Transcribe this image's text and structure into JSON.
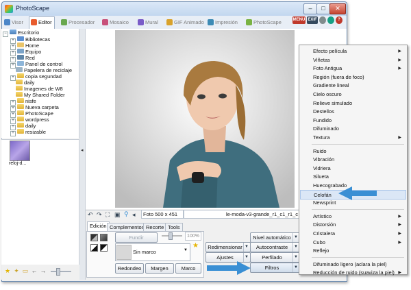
{
  "window": {
    "title": "PhotoScape",
    "min_glyph": "–",
    "max_glyph": "□",
    "close_glyph": "✕"
  },
  "tabs": [
    {
      "label": "Visor",
      "color": "#4b86c8",
      "active": false
    },
    {
      "label": "Editor",
      "color": "#e85c2e",
      "active": true
    },
    {
      "label": "Procesador",
      "color": "#6aa84f",
      "active": false
    },
    {
      "label": "Mosaico",
      "color": "#c8507a",
      "active": false
    },
    {
      "label": "Mural",
      "color": "#7a5cc8",
      "active": false
    },
    {
      "label": "GIF Animado",
      "color": "#d9a22b",
      "active": false
    },
    {
      "label": "Impresión",
      "color": "#3d8bb5",
      "active": false
    },
    {
      "label": "PhotoScape",
      "color": "#7ab343",
      "active": false
    }
  ],
  "header_icons": [
    {
      "label": "MENU",
      "color": "#c0392b"
    },
    {
      "label": "EXIF",
      "color": "#34495e"
    },
    {
      "label": "",
      "color": "#7f8c8d"
    },
    {
      "label": "",
      "color": "#16a085"
    },
    {
      "label": "?",
      "color": "#c0392b"
    }
  ],
  "tree": {
    "root": "Escritorio",
    "items": [
      {
        "label": "Bibliotecas",
        "expander": "+"
      },
      {
        "label": "Home",
        "expander": "+"
      },
      {
        "label": "Equipo",
        "expander": "+"
      },
      {
        "label": "Red",
        "expander": "+"
      },
      {
        "label": "Panel de control",
        "expander": "+"
      },
      {
        "label": "Papelera de reciclaje",
        "expander": ""
      },
      {
        "label": "copia segundad",
        "expander": "+"
      },
      {
        "label": "daily",
        "expander": ""
      },
      {
        "label": "Imagenes de W8",
        "expander": ""
      },
      {
        "label": "My Shared Folder",
        "expander": ""
      },
      {
        "label": "nisfe",
        "expander": "+"
      },
      {
        "label": "Nueva carpeta",
        "expander": "+"
      },
      {
        "label": "PhotoScape",
        "expander": "+"
      },
      {
        "label": "wordpress",
        "expander": "+"
      },
      {
        "label": "daily",
        "expander": "+"
      },
      {
        "label": "resizable",
        "expander": "+"
      }
    ]
  },
  "thumbnail": {
    "label": "reloj-d..."
  },
  "splitter_arrow": "◂",
  "photo": {
    "size_text": "Foto 500 x 451",
    "filename": "le-moda-v3-grande_r1_c1_r1_c"
  },
  "editor": {
    "tabs": [
      "Edición",
      "Complementos",
      "Recorte",
      "Tools"
    ],
    "fundir": "Fundir",
    "opacity": "100%",
    "frame": "Sin marco",
    "redondeo": "Redondeo",
    "margen": "Margen",
    "marco": "Marco",
    "redimensionar": "Redimensionar",
    "ajustes": "Ajustes",
    "nivel_automatico": "Nivel automático",
    "autocontraste": "Autocontraste",
    "perfilado": "Perfilado",
    "filtros": "Filtros"
  },
  "menu": {
    "items": [
      {
        "label": "Efecto película",
        "submenu": true
      },
      {
        "label": "Viñetas",
        "submenu": true
      },
      {
        "label": "Foto Antigua",
        "submenu": true
      },
      {
        "label": "Región (fuera de foco)",
        "submenu": false
      },
      {
        "label": "Gradiente lineal",
        "submenu": false
      },
      {
        "label": "Cielo oscuro",
        "submenu": false
      },
      {
        "label": "Relieve simulado",
        "submenu": false
      },
      {
        "label": "Destellos",
        "submenu": false
      },
      {
        "label": "Fundido",
        "submenu": false
      },
      {
        "label": "Difuminado",
        "submenu": false
      },
      {
        "label": "Textura",
        "submenu": true
      },
      {
        "label": "Ruido",
        "submenu": false
      },
      {
        "label": "Vibración",
        "submenu": false
      },
      {
        "label": "Vidriera",
        "submenu": false
      },
      {
        "label": "Silueta",
        "submenu": false
      },
      {
        "label": "Huecograbado",
        "submenu": false
      },
      {
        "label": "Celofán",
        "submenu": false,
        "highlighted": true
      },
      {
        "label": "Newsprint",
        "submenu": false
      },
      {
        "label": "Artístico",
        "submenu": true
      },
      {
        "label": "Distorsión",
        "submenu": true
      },
      {
        "label": "Cristalera",
        "submenu": true
      },
      {
        "label": "Cubo",
        "submenu": true
      },
      {
        "label": "Reflejo",
        "submenu": false
      },
      {
        "label": "Difuminado ligero (aclara la piel)",
        "submenu": false
      },
      {
        "label": "Reducción de ruido (suaviza la piel)",
        "submenu": true
      }
    ]
  },
  "colors": {
    "callout_arrow": "#3a8fd4",
    "highlight": "#dbe7f6"
  }
}
